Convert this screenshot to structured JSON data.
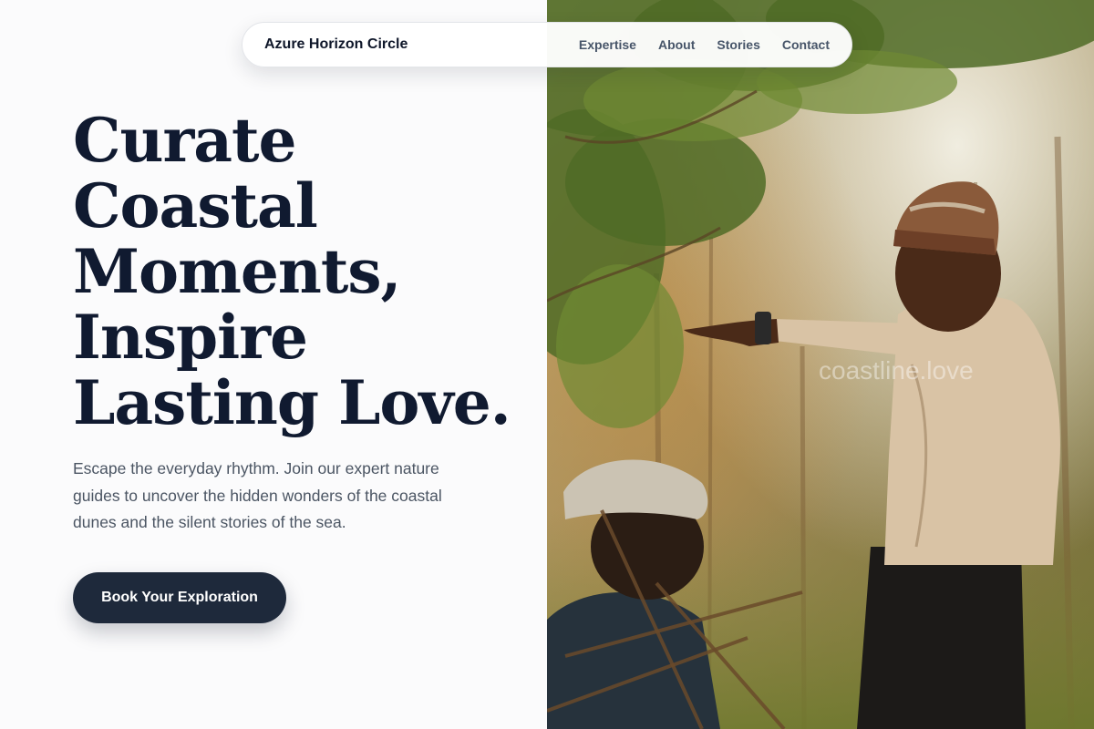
{
  "header": {
    "brand": "Azure Horizon Circle",
    "nav": [
      {
        "label": "Expertise"
      },
      {
        "label": "About"
      },
      {
        "label": "Stories"
      },
      {
        "label": "Contact"
      }
    ]
  },
  "hero": {
    "title_lines": [
      "Curate",
      "Coastal",
      "Moments,",
      "Inspire",
      "Lasting Love."
    ],
    "description": "Escape the everyday rhythm. Join our expert nature guides to uncover the hidden wonders of the coastal dunes and the silent stories of the sea.",
    "cta_label": "Book Your Exploration"
  },
  "photo": {
    "watermark": "coastline.love",
    "subject": "man in a knit cap pointing while standing among acacia trees, with a seated person in a cap in the foreground"
  },
  "colors": {
    "heading": "#101a30",
    "body_text": "#4b5563",
    "nav_text": "#475569",
    "cta_background": "#1e293b",
    "page_background": "#fbfbfc"
  }
}
